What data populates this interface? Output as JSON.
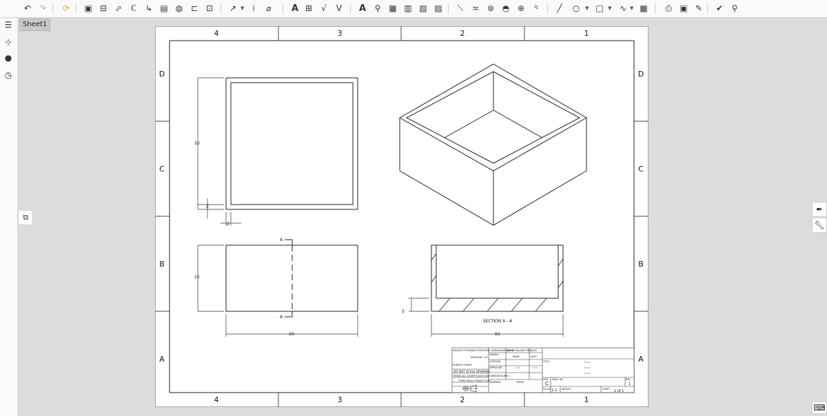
{
  "toolbar": {
    "buttons": [
      {
        "name": "undo-icon",
        "glyph": "↶"
      },
      {
        "name": "redo-icon",
        "glyph": "↷",
        "disabled": true
      },
      {
        "name": "update-icon",
        "glyph": "⟳",
        "accent": "#e8a630"
      },
      {
        "name": "insert-view-icon",
        "glyph": "▣"
      },
      {
        "name": "projected-view-icon",
        "glyph": "⊟"
      },
      {
        "name": "auxiliary-view-icon",
        "glyph": "⬀"
      },
      {
        "name": "section-view-icon",
        "glyph": "ℂ"
      },
      {
        "name": "aligned-section-icon",
        "glyph": "↳"
      },
      {
        "name": "detail-view-icon",
        "glyph": "▤"
      },
      {
        "name": "broken-view-icon",
        "glyph": "◍"
      },
      {
        "name": "break-view-icon",
        "glyph": "⊏"
      },
      {
        "name": "crop-view-icon",
        "glyph": "⊡"
      },
      {
        "name": "dimension-icon",
        "glyph": "↗"
      },
      {
        "name": "ordinate-dimension-icon",
        "glyph": "⁞"
      },
      {
        "name": "hole-callout-icon",
        "glyph": "⌀"
      },
      {
        "name": "note-icon",
        "glyph": "A"
      },
      {
        "name": "datum-icon",
        "glyph": "⊞"
      },
      {
        "name": "surface-finish-icon",
        "glyph": "√"
      },
      {
        "name": "weld-symbol-icon",
        "glyph": "ᐯ"
      },
      {
        "name": "text-icon",
        "glyph": "A"
      },
      {
        "name": "callout-icon",
        "glyph": "⚲"
      },
      {
        "name": "table-icon",
        "glyph": "▦"
      },
      {
        "name": "bom-table-icon",
        "glyph": "▥"
      },
      {
        "name": "hole-table-icon",
        "glyph": "▧"
      },
      {
        "name": "revision-table-icon",
        "glyph": "▨"
      },
      {
        "name": "centerline-icon",
        "glyph": "⟍"
      },
      {
        "name": "centermark-icon",
        "glyph": "≍"
      },
      {
        "name": "centermark-pattern-icon",
        "glyph": "⊛"
      },
      {
        "name": "edge-centerline-icon",
        "glyph": "◓"
      },
      {
        "name": "centermark-point-icon",
        "glyph": "⊕"
      },
      {
        "name": "thread-icon",
        "glyph": "⺀"
      },
      {
        "name": "line-icon",
        "glyph": "╱"
      },
      {
        "name": "circle-icon",
        "glyph": "○"
      },
      {
        "name": "rectangle-icon",
        "glyph": "□"
      },
      {
        "name": "spline-icon",
        "glyph": "∿"
      },
      {
        "name": "hatch-icon",
        "glyph": "▩"
      },
      {
        "name": "export-icon",
        "glyph": "⎙"
      },
      {
        "name": "image-icon",
        "glyph": "▣"
      },
      {
        "name": "pen-icon",
        "glyph": "✎"
      },
      {
        "name": "check-icon",
        "glyph": "✔"
      },
      {
        "name": "inspect-icon",
        "glyph": "⚲"
      }
    ]
  },
  "left_panel": {
    "items": [
      {
        "name": "feature-list-icon",
        "glyph": "☰"
      },
      {
        "name": "insert-part-icon",
        "glyph": "⊹"
      },
      {
        "name": "comments-icon",
        "glyph": "●"
      },
      {
        "name": "stopwatch-icon",
        "glyph": "◷"
      }
    ]
  },
  "sheet_tab": {
    "label": "Sheet1"
  },
  "drawing": {
    "zone_columns": [
      "4",
      "3",
      "2",
      "1"
    ],
    "zone_rows": [
      "D",
      "C",
      "B",
      "A"
    ],
    "dims": {
      "top_height": "50",
      "top_wall_y": "2",
      "top_wall_x": "2",
      "front_height": "25",
      "front_width": "50",
      "section_base": "5",
      "section_width": "50"
    },
    "section_label": "A",
    "section_title": "SECTION A - A",
    "title_block": {
      "general_note": "UNLESS OTHERWISE SPECIFIED: DIMENSIONS ARE IN MILLIMETERS",
      "angular_note": "ANGULAR: ±1°",
      "finish_label": "SURFACE FINISH",
      "no_scale": "DO NOT SCALE DRAWING",
      "break_edges": "BREAK ALL SHARP EDGES AND REMOVE BURRS",
      "projection": "THIRD ANGLE PROJECTION",
      "name_header": "NAME",
      "date_header": "DATE",
      "drawn_label": "DRAWN",
      "drawn_name": "NAME",
      "drawn_date": "DATE",
      "checked_label": "CHECKED",
      "approved_label": "APPROVED",
      "material_label": "MATERIAL",
      "finish_field": "FINISH",
      "title_label": "TITLE",
      "size_label": "SIZE",
      "size_value": "C",
      "dwg_label": "DWG. NO.",
      "rev_label": "REV",
      "rev_value": "1",
      "scale_label": "SCALE",
      "scale_value": "1:1",
      "weight_label": "WEIGHT",
      "sheet_label": "SHEET",
      "sheet_value": "1 of 1"
    }
  }
}
